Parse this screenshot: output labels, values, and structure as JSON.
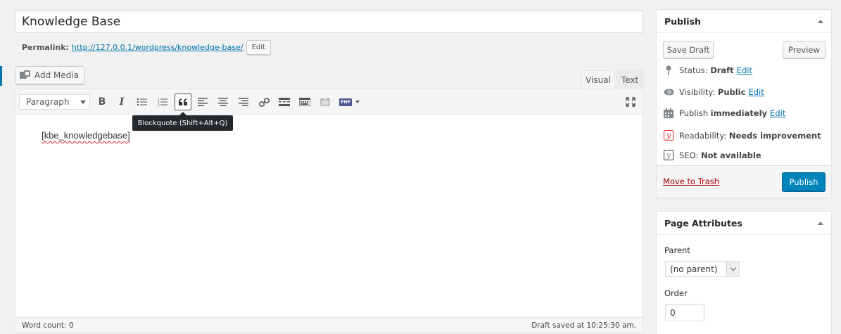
{
  "title": {
    "value": "Knowledge Base"
  },
  "permalink": {
    "label": "Permalink:",
    "url": "http://127.0.0.1/wordpress/knowledge-base/",
    "edit_label": "Edit"
  },
  "media": {
    "add_label": "Add Media"
  },
  "editor_tabs": [
    {
      "label": "Visual"
    },
    {
      "label": "Text"
    }
  ],
  "toolbar": {
    "format_value": "Paragraph",
    "buttons": [
      {
        "name": "bold-icon",
        "glyph": "B"
      },
      {
        "name": "italic-icon",
        "glyph": "I"
      },
      {
        "name": "bulleted-list-icon"
      },
      {
        "name": "numbered-list-icon"
      },
      {
        "name": "blockquote-icon"
      },
      {
        "name": "align-left-icon"
      },
      {
        "name": "align-center-icon"
      },
      {
        "name": "align-right-icon"
      },
      {
        "name": "link-icon"
      },
      {
        "name": "read-more-icon"
      },
      {
        "name": "toolbar-toggle-icon"
      },
      {
        "name": "shortcode-icon"
      },
      {
        "name": "php-icon",
        "glyph": "PHP"
      },
      {
        "name": "fullscreen-icon"
      }
    ],
    "tooltip": "Blockquote (Shift+Alt+Q)"
  },
  "content": {
    "text": "[kbe_knowledgebase]"
  },
  "statusbar": {
    "word_count": "Word count: 0",
    "saved": "Draft saved at 10:25:30 am."
  },
  "publish": {
    "title": "Publish",
    "save_draft": "Save Draft",
    "preview": "Preview",
    "status_label": "Status:",
    "status_value": "Draft",
    "visibility_label": "Visibility:",
    "visibility_value": "Public",
    "schedule_label": "Publish",
    "schedule_value": "immediately",
    "readability_label": "Readability:",
    "readability_value": "Needs improvement",
    "seo_label": "SEO:",
    "seo_value": "Not available",
    "edit_link": "Edit",
    "trash": "Move to Trash",
    "publish_button": "Publish"
  },
  "attributes": {
    "title": "Page Attributes",
    "parent_label": "Parent",
    "parent_value": "(no parent)",
    "order_label": "Order",
    "order_value": "0"
  },
  "colors": {
    "accent": "#0073aa",
    "primary_button": "#0085ba",
    "danger": "#a00",
    "yoast_red": "#dc3232"
  }
}
